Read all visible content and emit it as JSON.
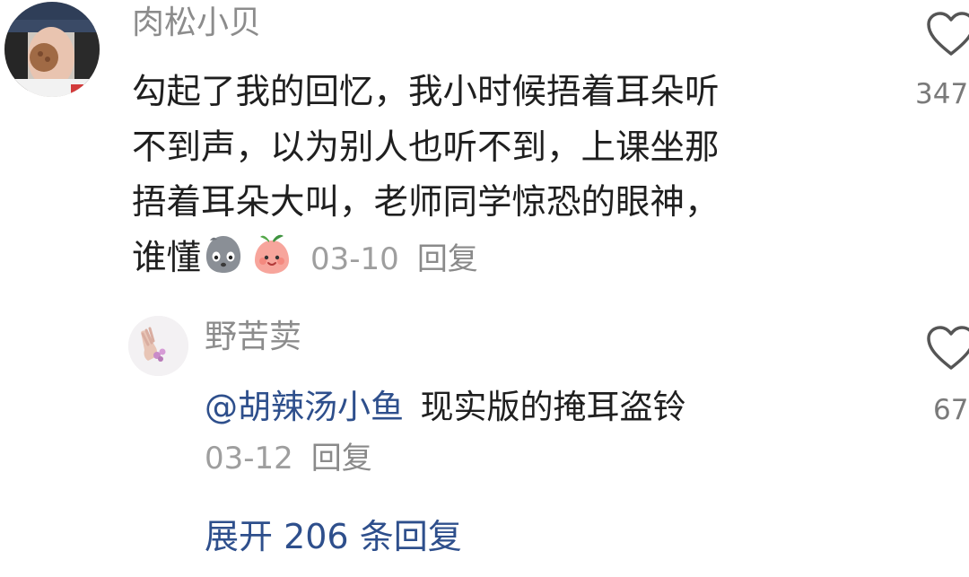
{
  "comment": {
    "username": "肉松小贝",
    "lines": [
      "勾起了我的回忆，我小时候捂着耳朵听",
      "不到声，以为别人也听不到，上课坐那",
      "捂着耳朵大叫，老师同学惊恐的眼神，",
      "谁懂"
    ],
    "emojis": [
      "sad-face-emoji",
      "smiling-peach-emoji"
    ],
    "date": "03-10",
    "reply_label": "回复",
    "likes": "347",
    "like_icon": "heart-outline-icon"
  },
  "reply": {
    "username": "野苦荬",
    "mention": "@胡辣汤小鱼",
    "text": "现实版的掩耳盗铃",
    "date": "03-12",
    "reply_label": "回复",
    "likes": "67",
    "like_icon": "heart-outline-icon"
  },
  "expand": {
    "label": "展开 206 条回复"
  },
  "colors": {
    "link": "#2e4f8c",
    "username": "#8c8c8c",
    "text": "#1f1f1f",
    "meta": "#9e9e9e"
  }
}
